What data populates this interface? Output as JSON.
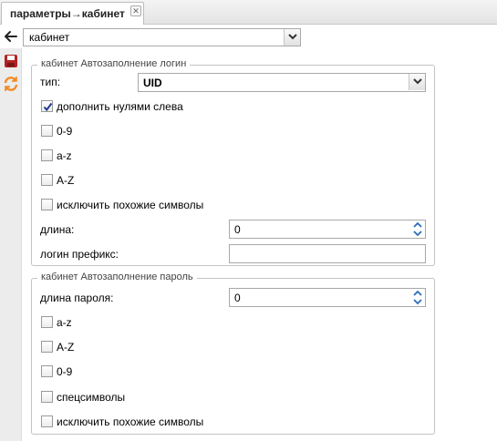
{
  "tab": {
    "title": "параметры→кабинет",
    "close_symbol": "✕"
  },
  "topbar": {
    "cabinet_select_value": "кабинет"
  },
  "login_section": {
    "legend": "кабинет Автозаполнение логин",
    "type_label": "тип:",
    "type_value": "UID",
    "checkboxes": [
      {
        "label": "дополнить нулями слева",
        "checked": true
      },
      {
        "label": "0-9",
        "checked": false
      },
      {
        "label": "a-z",
        "checked": false
      },
      {
        "label": "A-Z",
        "checked": false
      },
      {
        "label": "исключить похожие символы",
        "checked": false
      }
    ],
    "length_label": "длина:",
    "length_value": "0",
    "prefix_label": "логин префикс:",
    "prefix_value": ""
  },
  "password_section": {
    "legend": "кабинет Автозаполнение пароль",
    "length_label": "длина пароля:",
    "length_value": "0",
    "checkboxes": [
      {
        "label": "a-z",
        "checked": false
      },
      {
        "label": "A-Z",
        "checked": false
      },
      {
        "label": "0-9",
        "checked": false
      },
      {
        "label": "спецсимволы",
        "checked": false
      },
      {
        "label": "исключить похожие символы",
        "checked": false
      }
    ]
  },
  "colors": {
    "refresh_icon": "#f08a24",
    "save_icon": "#b22222"
  }
}
